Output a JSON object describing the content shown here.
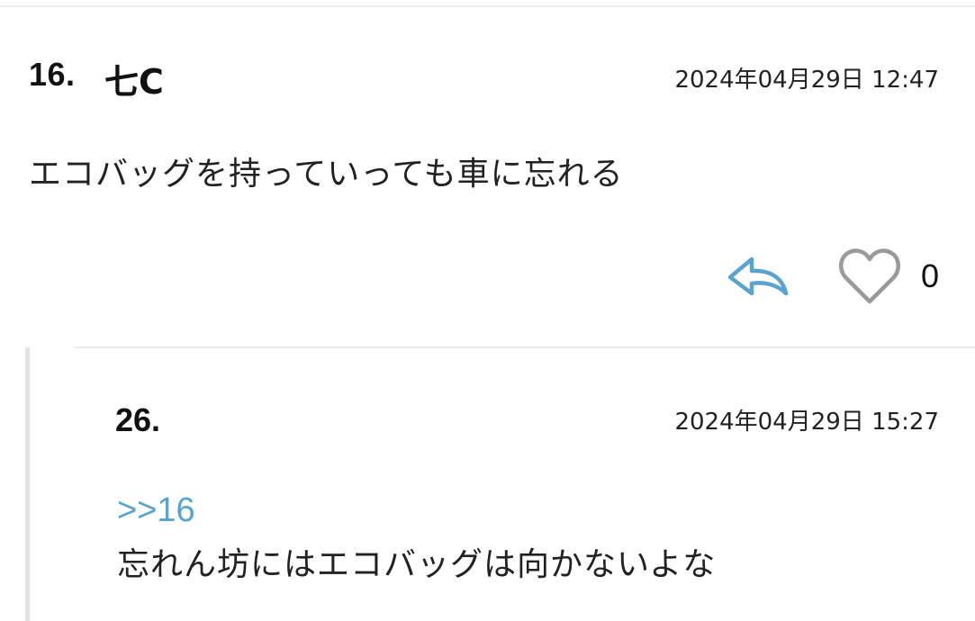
{
  "post": {
    "number": "16.",
    "author": "七C",
    "date": "2024年04月29日 12:47",
    "body": "エコバッグを持っていっても車に忘れる",
    "like_count": "0",
    "icons": {
      "reply": "reply-arrow-icon",
      "like": "heart-outline-icon"
    },
    "colors": {
      "reply_icon": "#5aa3cf",
      "like_icon": "#9a9a9a"
    }
  },
  "reply": {
    "number": "26.",
    "date": "2024年04月29日 15:27",
    "anchor": ">>16",
    "body": "忘れん坊にはエコバッグは向かないよな",
    "colors": {
      "anchor": "#5aa3cf"
    }
  }
}
